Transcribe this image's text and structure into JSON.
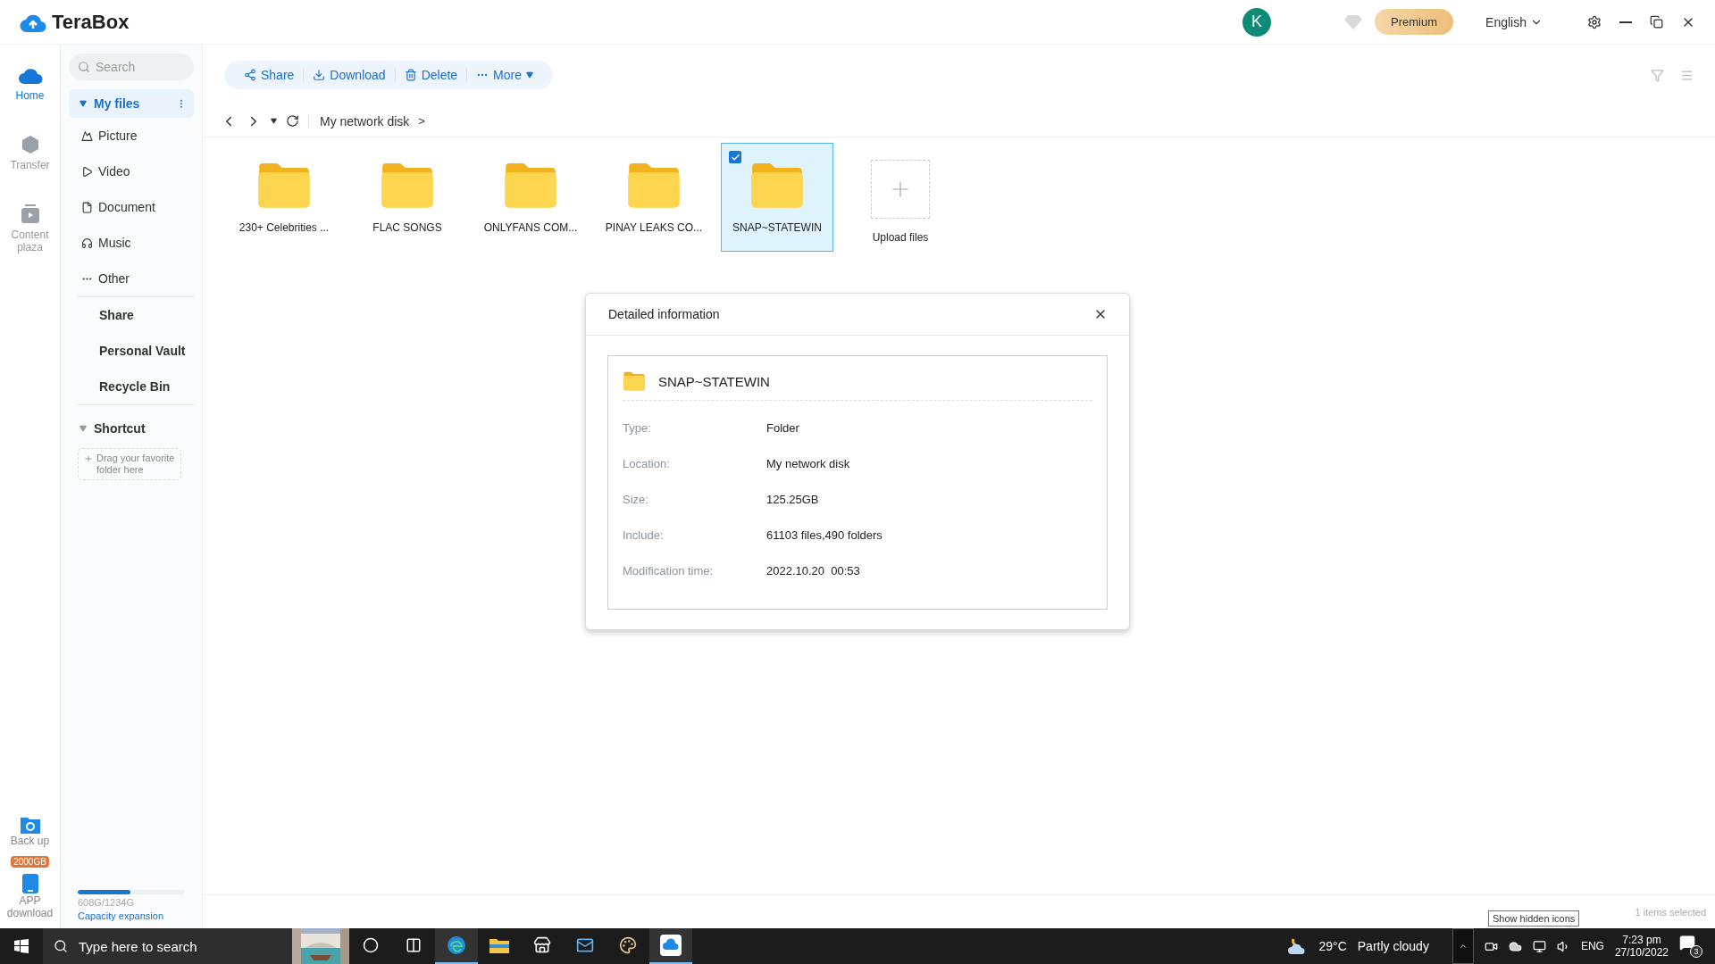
{
  "header": {
    "logo": "TeraBox",
    "avatar": "K",
    "premium": "Premium",
    "language": "English"
  },
  "rail": {
    "items": [
      {
        "label": "Home",
        "kind": "home",
        "selected": true
      },
      {
        "label": "Transfer",
        "kind": "transfer",
        "selected": false
      },
      {
        "label": "Content plaza",
        "kind": "plaza",
        "selected": false
      }
    ],
    "backup": "Back up",
    "badge": "2000GB",
    "app": "APP download"
  },
  "sidebar": {
    "search": {
      "placeholder": "Search"
    },
    "my_files": {
      "label": "My files",
      "expanded": true,
      "selected": true,
      "children": [
        {
          "label": "Picture",
          "kind": "picture",
          "selected": false
        },
        {
          "label": "Video",
          "kind": "video",
          "selected": false
        },
        {
          "label": "Document",
          "kind": "document",
          "selected": false
        },
        {
          "label": "Music",
          "kind": "music",
          "selected": false
        },
        {
          "label": "Other",
          "kind": "other",
          "selected": false
        }
      ]
    },
    "sections": [
      {
        "label": "Share",
        "selected": false
      },
      {
        "label": "Personal Vault",
        "selected": false
      },
      {
        "label": "Recycle Bin",
        "selected": false
      }
    ],
    "shortcut": {
      "label": "Shortcut",
      "expanded": true,
      "hint": "Drag your favorite folder here"
    },
    "storage": {
      "level": 0.49,
      "usage": "608G/1234G",
      "link": "Capacity expansion"
    }
  },
  "toolbar": [
    {
      "label": "Share",
      "kind": "share"
    },
    {
      "label": "Download",
      "kind": "download"
    },
    {
      "label": "Delete",
      "kind": "delete"
    },
    {
      "label": "More",
      "kind": "more"
    }
  ],
  "breadcrumb": {
    "path": "My network disk",
    "separator": ">"
  },
  "files": [
    {
      "name": "230+ Celebrities ...",
      "kind": "folder",
      "selected": false
    },
    {
      "name": "FLAC SONGS",
      "kind": "folder",
      "selected": false
    },
    {
      "name": "ONLYFANS COM...",
      "kind": "folder",
      "selected": false
    },
    {
      "name": "PINAY LEAKS CO...",
      "kind": "folder",
      "selected": false
    },
    {
      "name": "SNAP~STATEWIN",
      "kind": "folder",
      "selected": true
    },
    {
      "name": "Upload files",
      "kind": "upload",
      "selected": false
    }
  ],
  "dialog": {
    "title": "Detailed information",
    "name": "SNAP~STATEWIN",
    "rows": [
      {
        "label": "Type:",
        "value": "Folder"
      },
      {
        "label": "Location:",
        "value": "My network disk"
      },
      {
        "label": "Size:",
        "value": "125.25GB"
      },
      {
        "label": "Include:",
        "value": "61103 files,490 folders"
      },
      {
        "label": "Modification time:",
        "value": "2022.10.20  00:53"
      }
    ]
  },
  "status_bar": {
    "text": "1 items selected"
  },
  "tooltip": "Show hidden icons",
  "taskbar": {
    "search": {
      "placeholder": "Type here to search"
    },
    "apps": [
      {
        "kind": "cortana",
        "selected": false
      },
      {
        "kind": "taskview",
        "selected": false
      },
      {
        "kind": "edge",
        "selected": true
      },
      {
        "kind": "explorer",
        "selected": false
      },
      {
        "kind": "store",
        "selected": false
      },
      {
        "kind": "mail",
        "selected": false
      },
      {
        "kind": "paint",
        "selected": false
      },
      {
        "kind": "terabox",
        "selected": true
      }
    ],
    "temperature": "29°C",
    "weather": "Partly cloudy",
    "language": "ENG",
    "time": "7:23 pm",
    "date": "27/10/2022",
    "notifications": "3"
  }
}
